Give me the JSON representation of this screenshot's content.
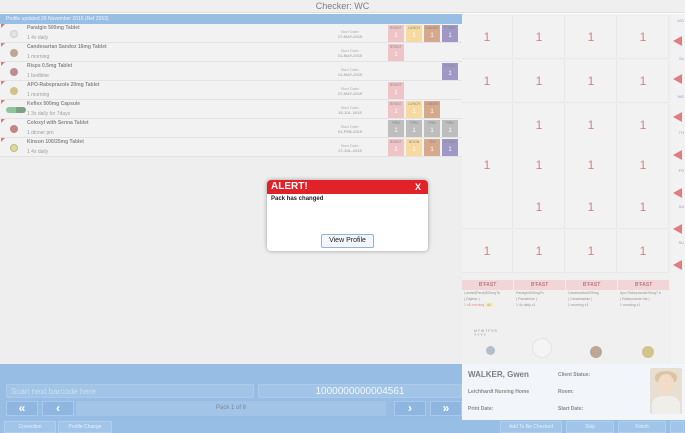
{
  "title": "Checker: WC",
  "updated": "Profile updated 26 November 2015 (Ref 2553)",
  "meds": [
    {
      "name": "Paralgin 500mg Tablet",
      "directions": "1 4x daily",
      "start_label": "Start Date:",
      "start_date": "27-MAY-2015",
      "pill_color": "#cfcfcf"
    },
    {
      "name": "Candesartan Sandoz 16mg Tablet",
      "directions": "1 morning",
      "start_label": "Start Date:",
      "start_date": "21-MAY-2015",
      "pill_color": "#8e6a4e"
    },
    {
      "name": "Risps 0.5mg Tablet",
      "directions": "1 bedtime",
      "start_label": "Start Date:",
      "start_date": "21-MAY-2015",
      "pill_color": "#8d3b3b"
    },
    {
      "name": "APO-Rabeprazole 20mg Tablet",
      "directions": "1 morning",
      "start_label": "Start Date:",
      "start_date": "27-MAY-2015",
      "pill_color": "#b29534"
    },
    {
      "name": "Keflex 500mg Capsule",
      "directions": "1 3x daily for 7days",
      "start_label": "Start Date:",
      "start_date": "15-JUL-2015",
      "pill_color": "#3e9a52"
    },
    {
      "name": "Coloxyl with Senna Tablet",
      "directions": "1 dinner prn",
      "start_label": "Start Date:",
      "start_date": "01-FEB-2015",
      "pill_color": "#9b2d2d"
    },
    {
      "name": "Kinson 100/25mg Tablet",
      "directions": "1 4x daily",
      "start_label": "Start Date:",
      "start_date": "27-JUL-2015",
      "pill_color": "#c8c04a"
    }
  ],
  "slot_labels": {
    "bfast": "B'FAST",
    "lunch": "LUNCH",
    "dinner": "DINNER",
    "bedtime": "B'TIME",
    "prn": "PRN",
    "noon": "NOON",
    "tea": "TEA"
  },
  "dose_value": "1",
  "grid_values": [
    "1",
    "1",
    "1",
    "1",
    "1",
    "1",
    "1",
    "1",
    "1",
    "1",
    "1",
    "1",
    "1",
    "1",
    "1",
    "1",
    "1",
    "1",
    "1",
    "1",
    "1",
    "1",
    "1"
  ],
  "right_strip_labels": [
    "MO",
    "Ex",
    "WE",
    "TH",
    "FR",
    "SA",
    "SU"
  ],
  "pack_columns": [
    {
      "header": "B'FAST",
      "line1": "Lamisil(Paral)500mgTb",
      "line2": "( Digesic )",
      "line3": "1 x8 morning",
      "qty": "x1"
    },
    {
      "header": "B'FAST",
      "line1": "Paralgin500mgTb",
      "line2": "( Panadeine )",
      "line3": "1 4x daily",
      "qty": "x1"
    },
    {
      "header": "B'FAST",
      "line1": "Candesartan525mg",
      "line2": "( Candesartan )",
      "line3": "1 morning",
      "qty": "x1"
    },
    {
      "header": "B'FAST",
      "line1": "Apo-Rabeprazole20mgT b",
      "line2": "( Rabeprazole Na )",
      "line3": "1 morning",
      "qty": "x1"
    }
  ],
  "week_letters": "M T W T F S S",
  "week_marks": "Y Y   Y   Y",
  "scan_placeholder": "Scan next barcode here",
  "barcode": "1000000000004561",
  "pack_label": "Pack 1 of 8",
  "patient": {
    "name": "WALKER, Gwen",
    "home": "Leichhardt Nursing Home",
    "print_label": "Print Date:",
    "status_label": "Client Status:",
    "room_label": "Room:",
    "start_label": "Start Date:"
  },
  "footer": {
    "correction": "Correction",
    "profile_change": "Profile Change",
    "add_checked": "Add To Be Checked",
    "skip": "Skip",
    "finish": "Finish"
  },
  "alert": {
    "title": "ALERT!",
    "close": "X",
    "message": "Pack has changed",
    "button": "View Profile"
  }
}
